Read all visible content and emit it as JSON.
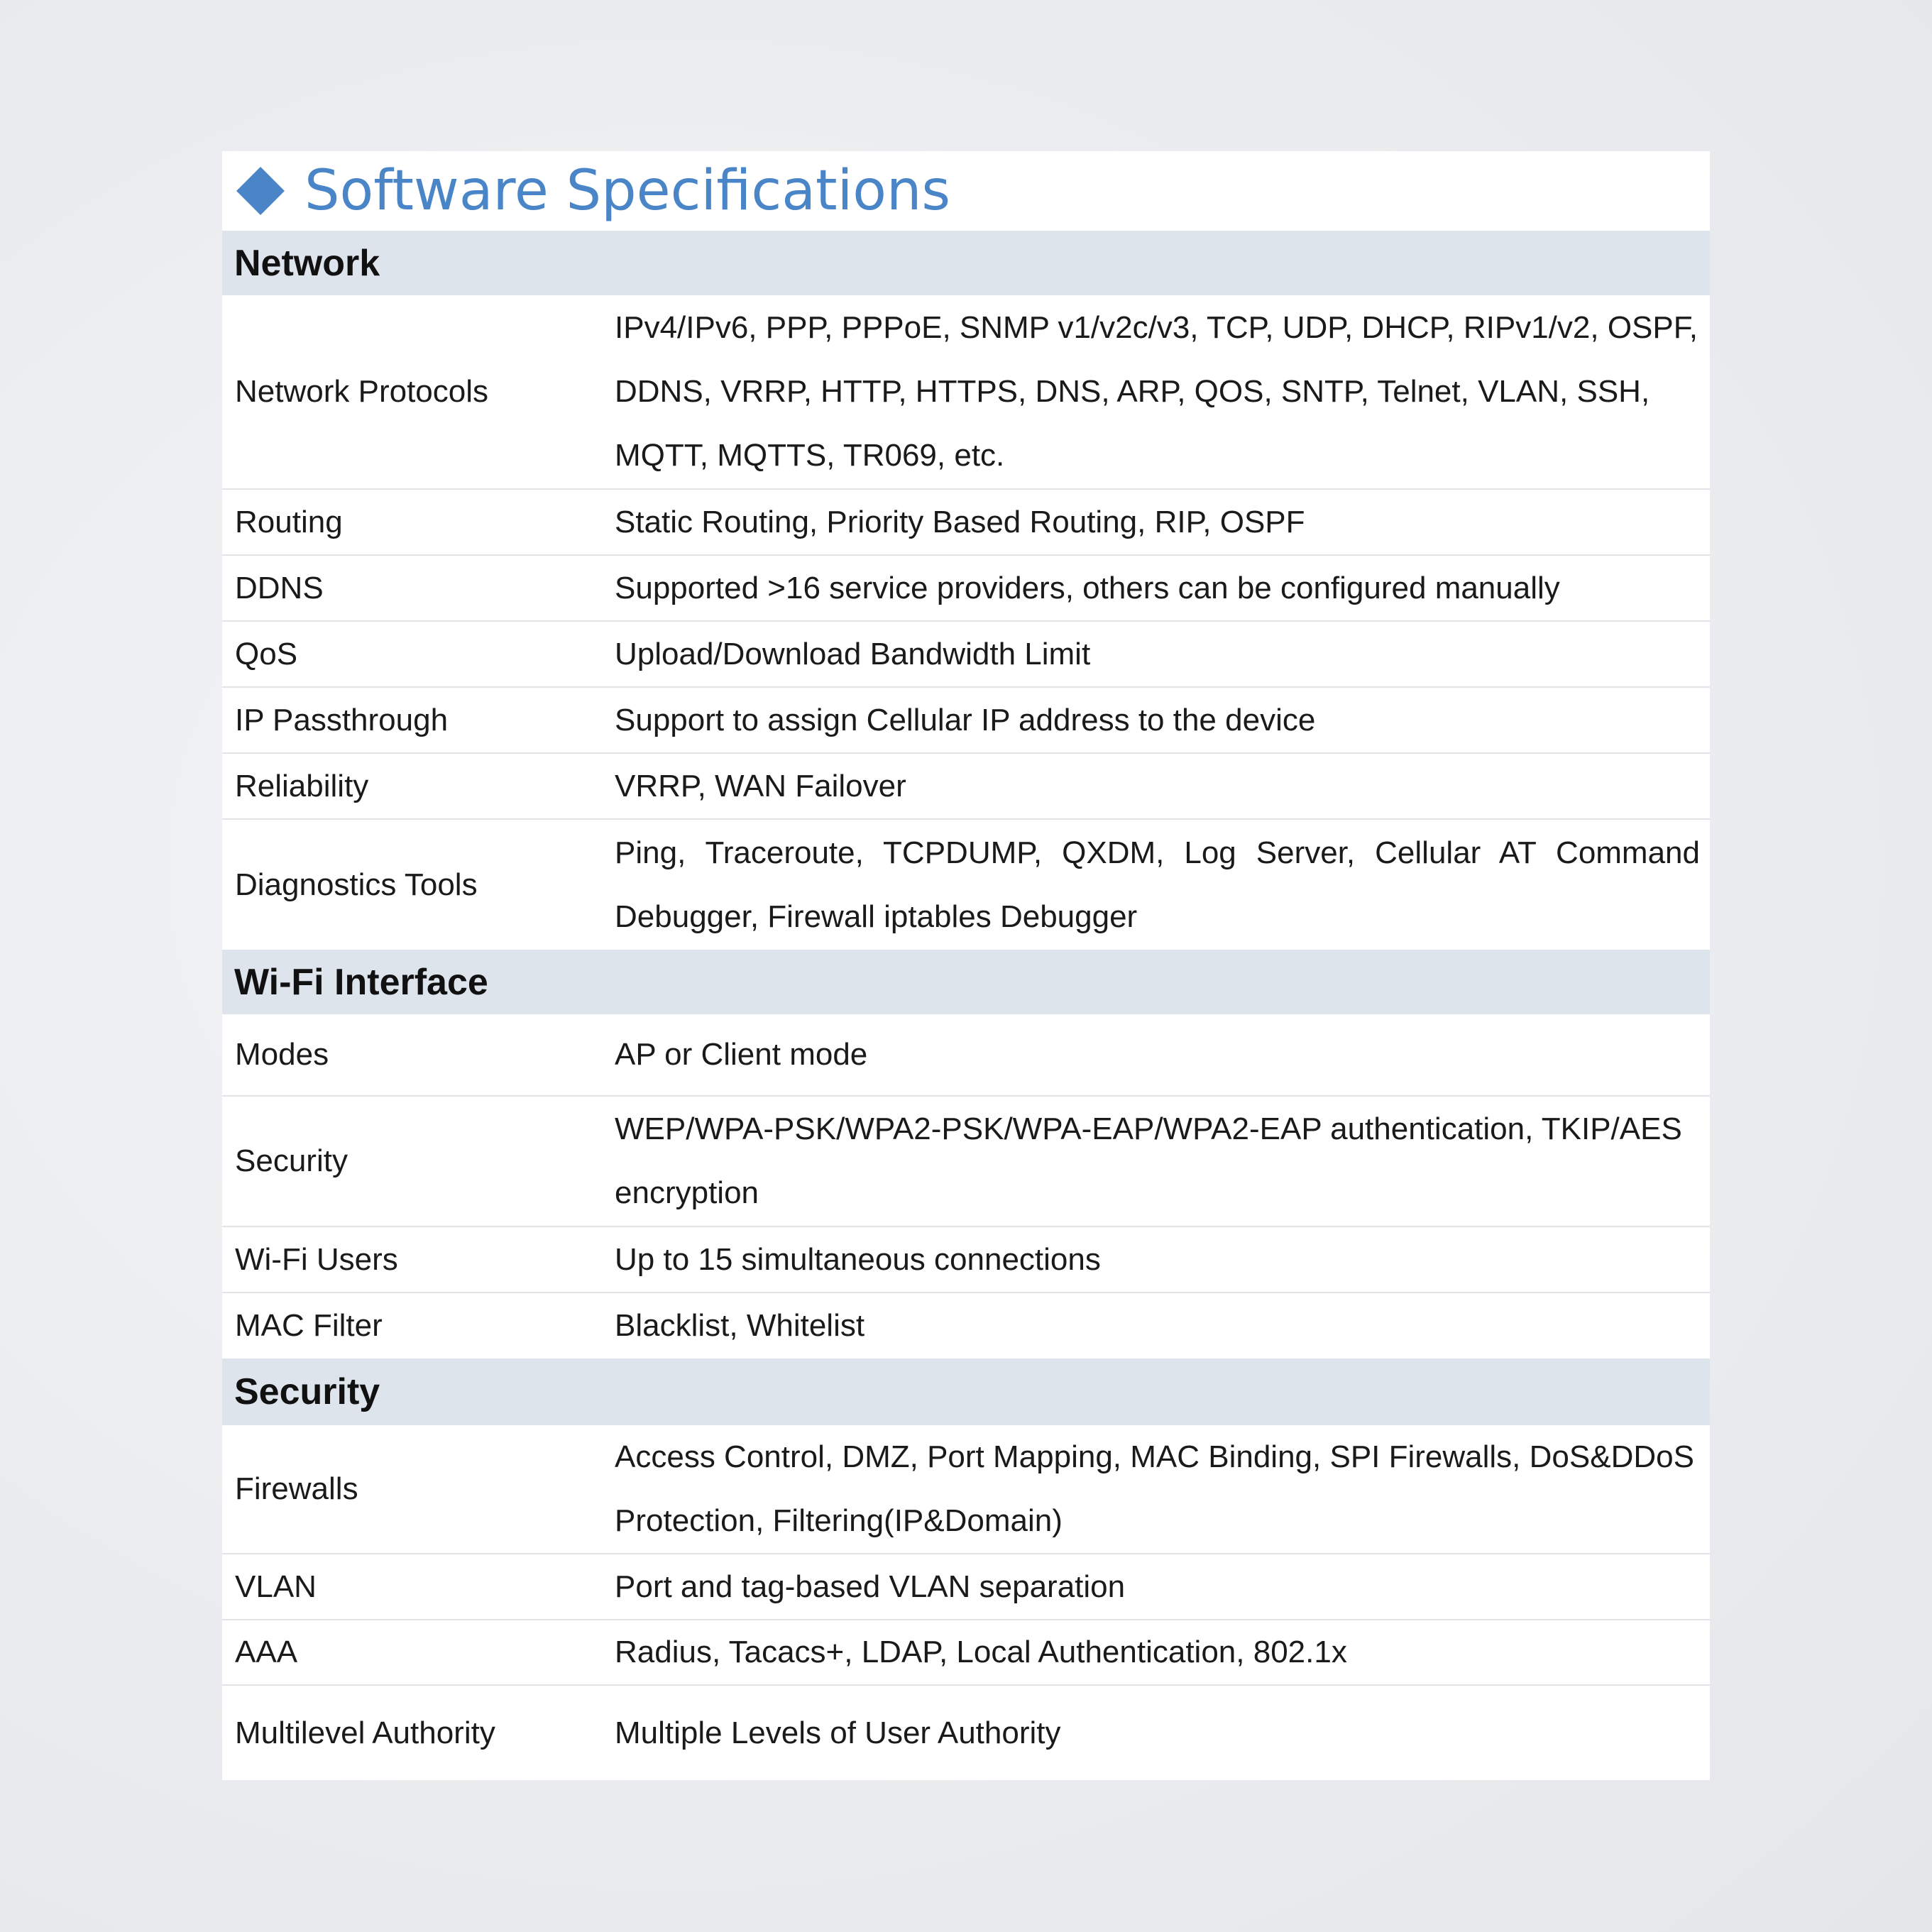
{
  "title": "Software Specifications",
  "colors": {
    "accent": "#4a86c7",
    "section_bg": "#dde4ec",
    "divider": "#e2e4e7"
  },
  "sections": [
    {
      "header": "Network",
      "rows": [
        {
          "label": "Network Protocols",
          "value": "IPv4/IPv6, PPP, PPPoE, SNMP v1/v2c/v3, TCP, UDP, DHCP, RIPv1/v2, OSPF, DDNS, VRRP, HTTP, HTTPS, DNS, ARP, QOS, SNTP, Telnet, VLAN, SSH, MQTT, MQTTS, TR069, etc."
        },
        {
          "label": "Routing",
          "value": "Static Routing, Priority Based Routing, RIP, OSPF"
        },
        {
          "label": "DDNS",
          "value": "Supported >16 service providers, others can be configured manually"
        },
        {
          "label": "QoS",
          "value": "Upload/Download Bandwidth Limit"
        },
        {
          "label": "IP Passthrough",
          "value": "Support to assign Cellular IP address to the device"
        },
        {
          "label": "Reliability",
          "value": "VRRP, WAN Failover"
        },
        {
          "label": "Diagnostics Tools",
          "value": "Ping, Traceroute, TCPDUMP, QXDM, Log Server, Cellular AT Command Debugger, Firewall iptables Debugger"
        }
      ]
    },
    {
      "header": "Wi-Fi Interface",
      "rows": [
        {
          "label": "Modes",
          "value": "AP or Client mode"
        },
        {
          "label": "Security",
          "value": "WEP/WPA-PSK/WPA2-PSK/WPA-EAP/WPA2-EAP authentication, TKIP/AES encryption"
        },
        {
          "label": "Wi-Fi Users",
          "value": "Up to 15 simultaneous connections"
        },
        {
          "label": "MAC Filter",
          "value": "Blacklist, Whitelist"
        }
      ]
    },
    {
      "header": "Security",
      "rows": [
        {
          "label": "Firewalls",
          "value": "Access Control, DMZ, Port Mapping, MAC Binding, SPI Firewalls, DoS&DDoS Protection, Filtering(IP&Domain)"
        },
        {
          "label": "VLAN",
          "value": "Port and tag-based VLAN separation"
        },
        {
          "label": "AAA",
          "value": "Radius, Tacacs+, LDAP, Local Authentication, 802.1x"
        },
        {
          "label": "Multilevel Authority",
          "value": "Multiple Levels of User Authority"
        }
      ]
    }
  ]
}
